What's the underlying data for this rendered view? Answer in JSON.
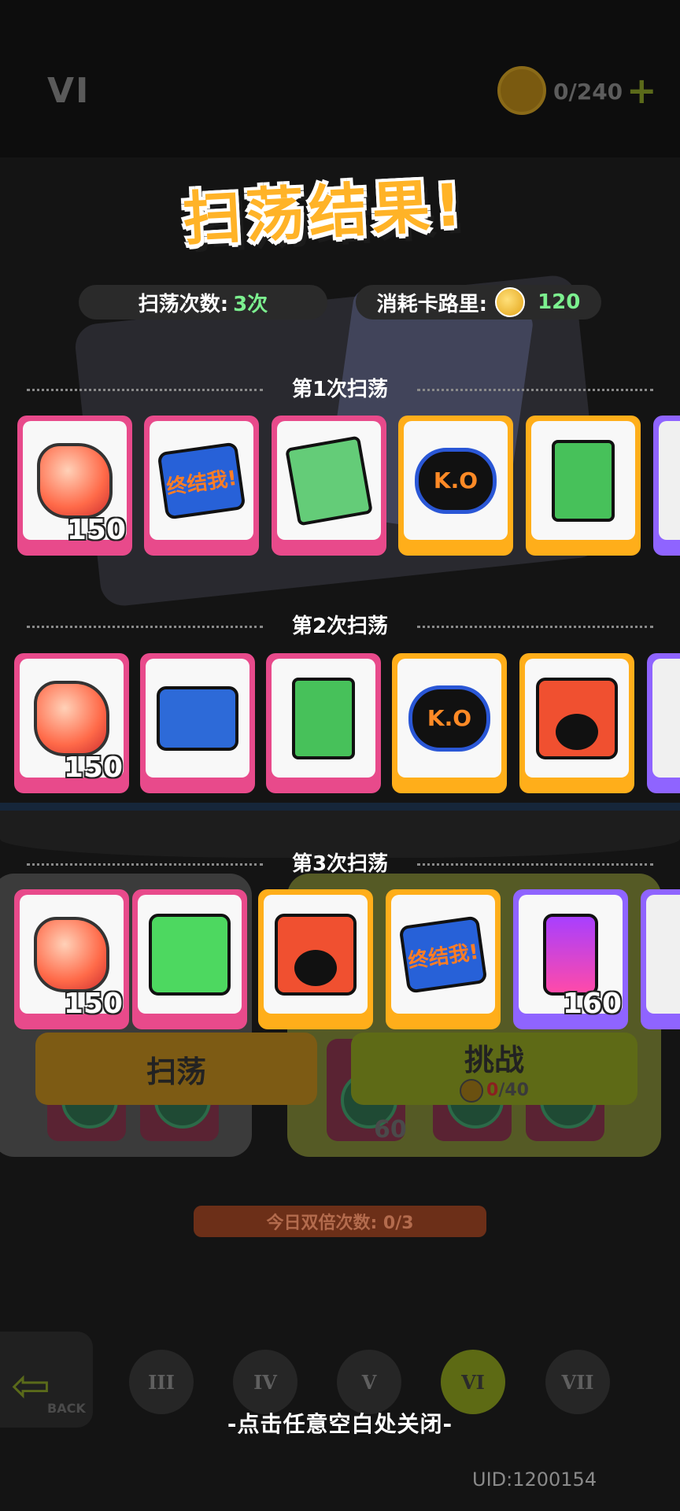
{
  "header": {
    "stage": "VI",
    "coins": "0/240",
    "plus": "+"
  },
  "result": {
    "title": "扫荡结果!",
    "times_label": "扫荡次数:",
    "times_value": "3次",
    "cost_label": "消耗卡路里:",
    "cost_value": "120"
  },
  "sweeps": [
    {
      "title": "第1次扫荡",
      "items": [
        {
          "frame": "pink",
          "art": "gem",
          "qty": "150"
        },
        {
          "frame": "pink",
          "art": "blue-sticker",
          "text": "终结我!",
          "qty": ""
        },
        {
          "frame": "pink",
          "art": "green-sticker",
          "qty": ""
        },
        {
          "frame": "orange",
          "art": "ko-sticker",
          "text": "K.O",
          "qty": ""
        },
        {
          "frame": "orange",
          "art": "box-sticker",
          "qty": ""
        }
      ]
    },
    {
      "title": "第2次扫荡",
      "items": [
        {
          "frame": "pink",
          "art": "gem",
          "qty": "150"
        },
        {
          "frame": "pink",
          "art": "mole-sticker",
          "qty": ""
        },
        {
          "frame": "pink",
          "art": "box-sticker",
          "qty": ""
        },
        {
          "frame": "orange",
          "art": "ko-sticker",
          "text": "K.O",
          "qty": ""
        },
        {
          "frame": "orange",
          "art": "fire-sticker",
          "qty": ""
        }
      ]
    },
    {
      "title": "第3次扫荡",
      "items": [
        {
          "frame": "pink",
          "art": "gem",
          "qty": "150"
        },
        {
          "frame": "pink",
          "art": "welcome-sticker",
          "qty": ""
        },
        {
          "frame": "orange",
          "art": "fire-sticker",
          "qty": ""
        },
        {
          "frame": "orange",
          "art": "blue-sticker",
          "text": "终结我!",
          "qty": ""
        },
        {
          "frame": "purple",
          "art": "spray-can",
          "qty": "160"
        }
      ]
    }
  ],
  "background": {
    "double_count": "今日双倍次数: 0/3",
    "sweep_button": "扫荡",
    "challenge_button": "挑战",
    "challenge_cost_current": "0",
    "challenge_cost_total": "/40",
    "bg_qty": "60",
    "back_label": "BACK",
    "stages": [
      "III",
      "IV",
      "V",
      "VI",
      "VII"
    ]
  },
  "footer": {
    "close_hint": "-点击任意空白处关闭-",
    "uid": "UID:1200154"
  },
  "colors": {
    "title": "#ffb327",
    "accent_green": "#7cf08f",
    "frame_pink": "#e84a8b",
    "frame_orange": "#ffae1a",
    "frame_purple": "#8f64ff"
  }
}
